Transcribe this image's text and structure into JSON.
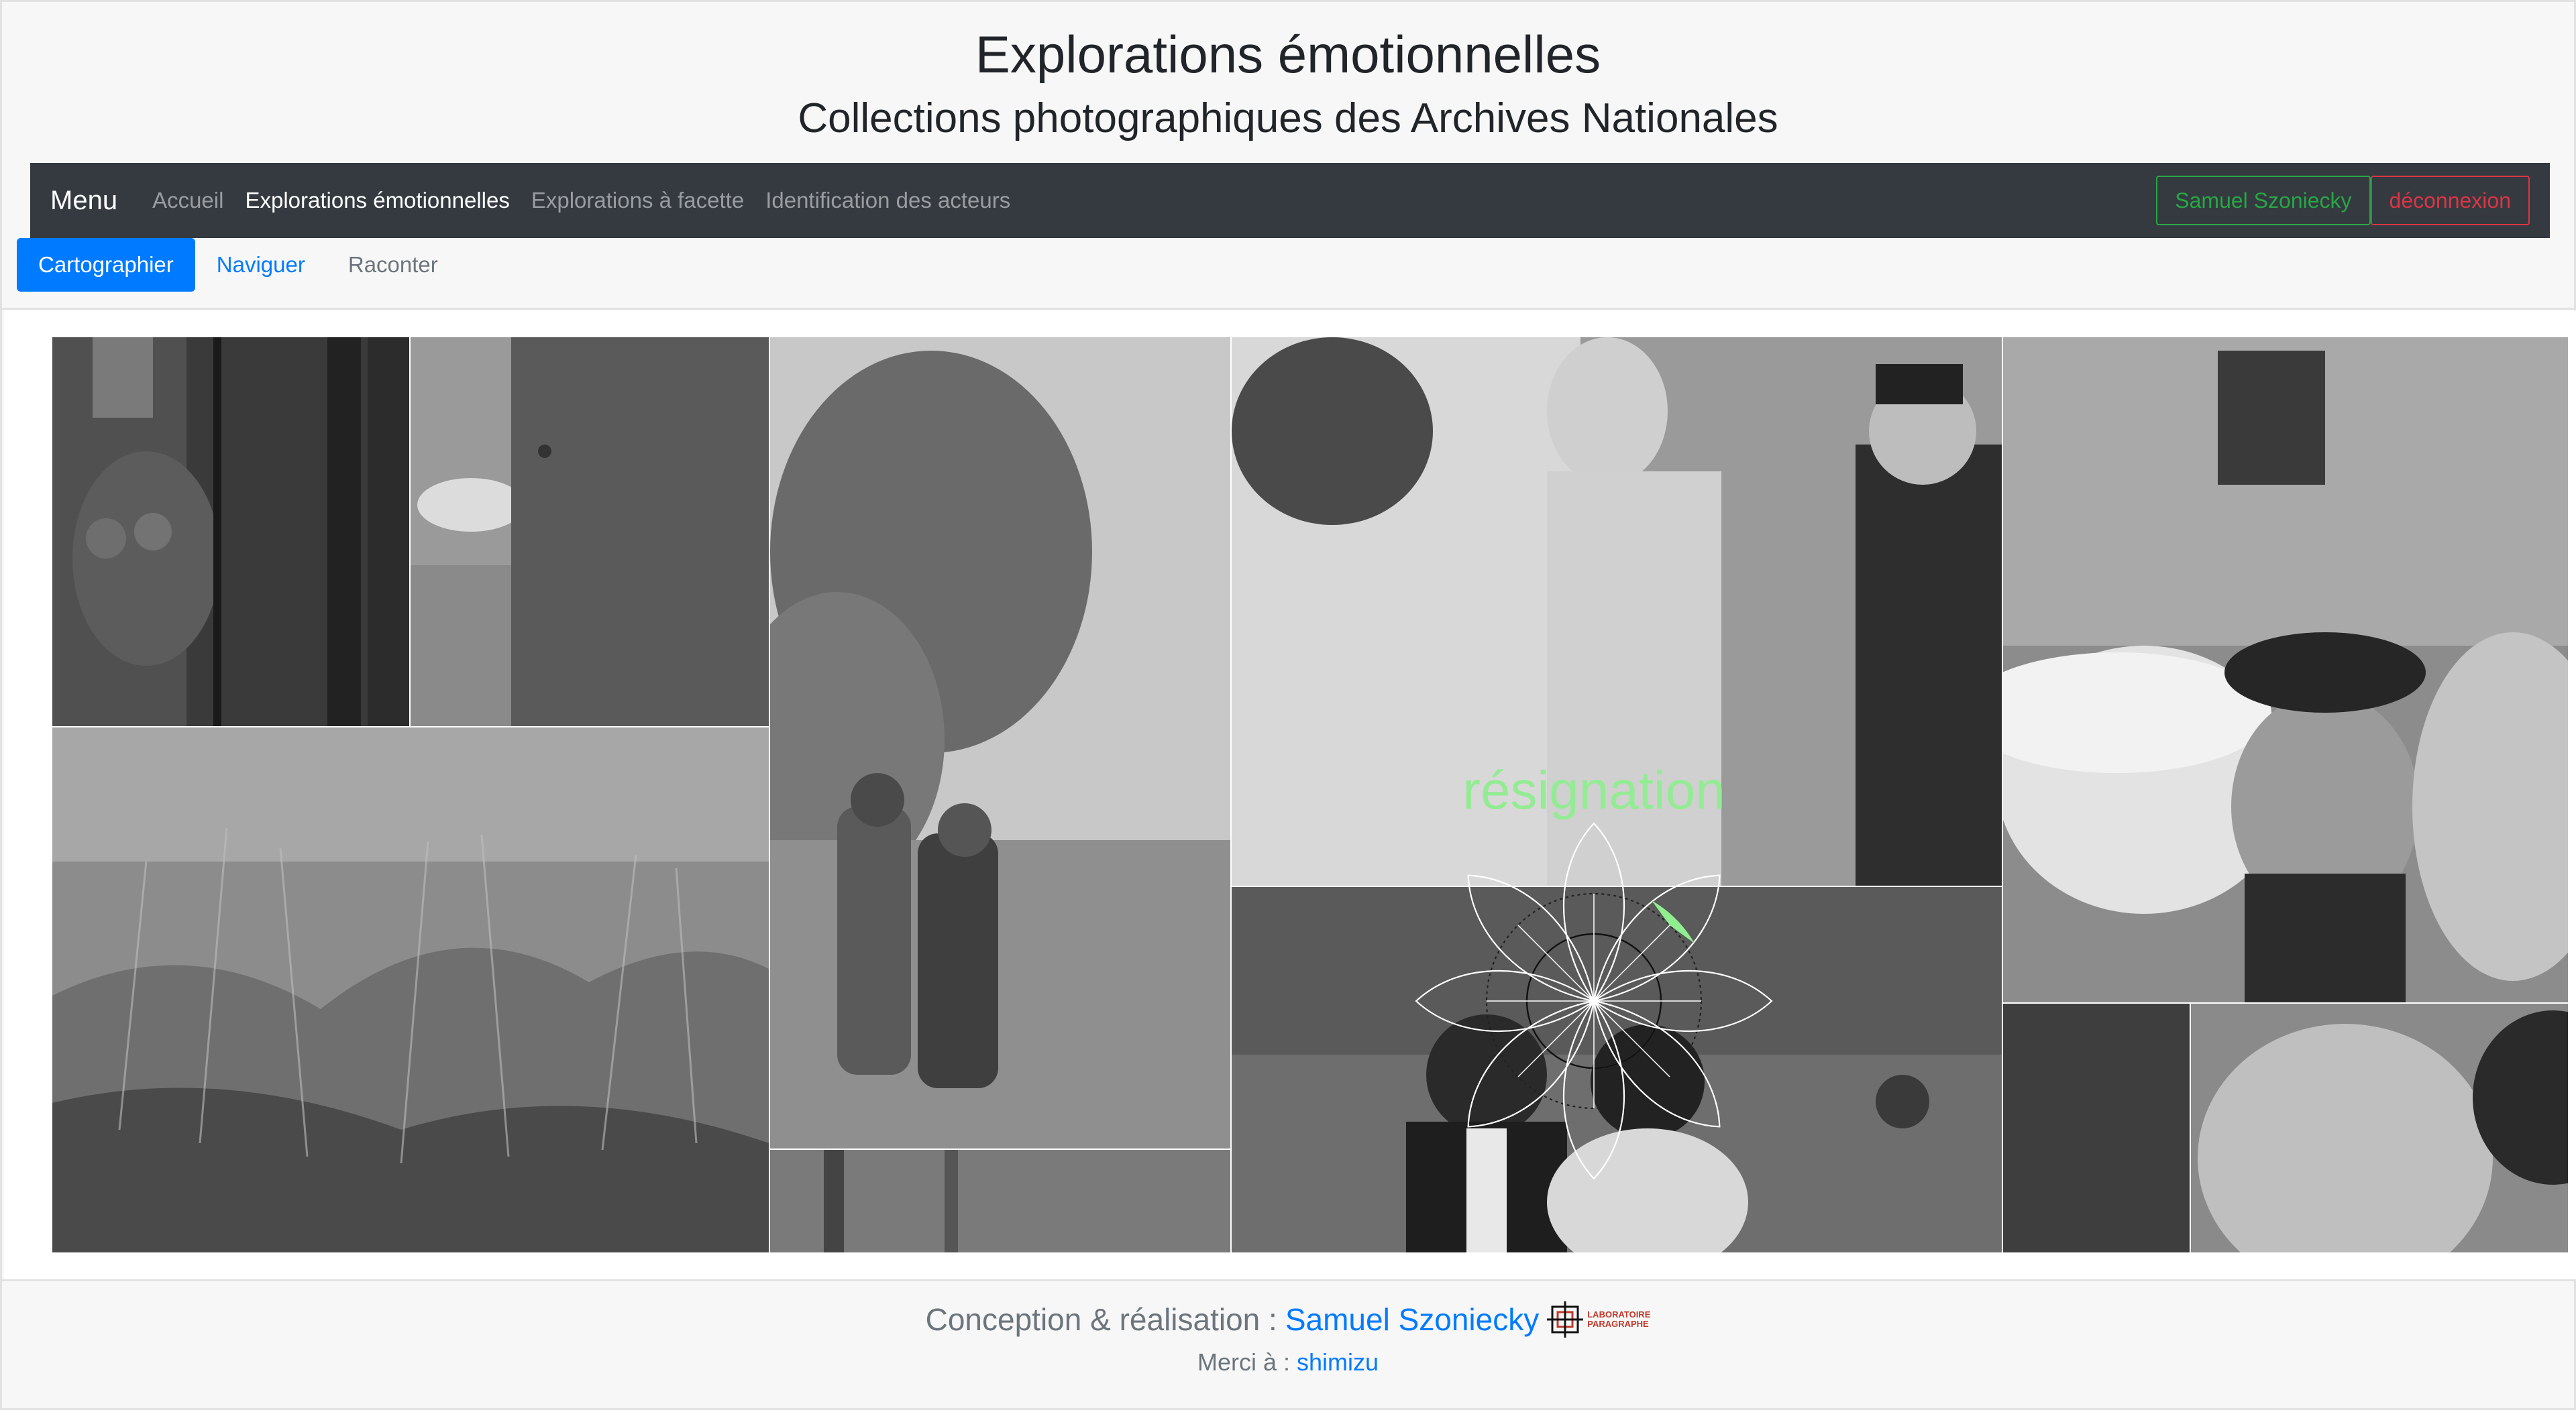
{
  "header": {
    "title": "Explorations émotionnelles",
    "subtitle": "Collections photographiques des Archives Nationales"
  },
  "navbar": {
    "brand": "Menu",
    "links": [
      {
        "label": "Accueil",
        "active": false
      },
      {
        "label": "Explorations émotionnelles",
        "active": true
      },
      {
        "label": "Explorations à facette",
        "active": false
      },
      {
        "label": "Identification des acteurs",
        "active": false
      }
    ],
    "user_label": "Samuel Szoniecky",
    "logout_label": "déconnexion"
  },
  "subnav": {
    "tabs": [
      {
        "label": "Cartographier",
        "active": true
      },
      {
        "label": "Naviguer",
        "active": false
      },
      {
        "label": "Raconter",
        "active": false
      }
    ]
  },
  "emotion": {
    "label": "résignation",
    "highlight_color": "#90ee90"
  },
  "footer": {
    "credit_prefix": "Conception & réalisation :",
    "credit_name": "Samuel Szoniecky",
    "logo_line1": "LABORATOIRE",
    "logo_line2": "PARAGRAPHE",
    "thanks_prefix": "Merci à :",
    "thanks_name": "shimizu"
  },
  "colors": {
    "navbar_bg": "#343a40",
    "primary": "#007bff",
    "success": "#28a745",
    "danger": "#dc3545"
  }
}
